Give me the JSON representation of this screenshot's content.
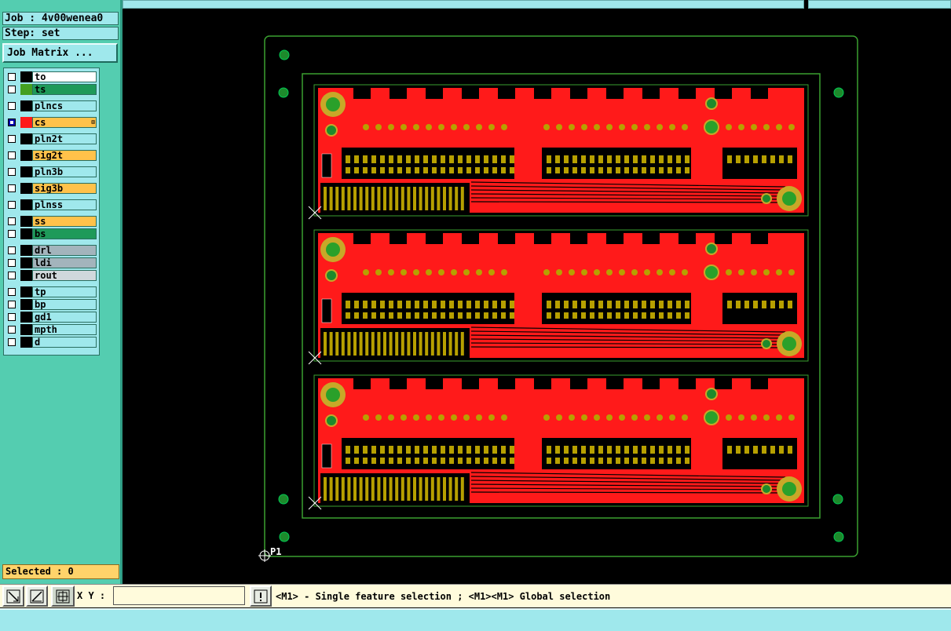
{
  "job": {
    "label": "Job : ",
    "value": "4v00wenea0"
  },
  "step": {
    "label": "Step: ",
    "value": "set"
  },
  "job_matrix_button": "Job Matrix ...",
  "layers": [
    {
      "name": "to",
      "color": "#ffffff",
      "checked": false,
      "swatch": "black"
    },
    {
      "name": "ts",
      "color": "#1e9a5a",
      "checked": false,
      "swatch": "green"
    },
    {
      "name": "plncs",
      "color": "#9fe8ec",
      "checked": false,
      "swatch": "black"
    },
    {
      "name": "cs",
      "color": "#ffc24a",
      "checked": true,
      "swatch": "red",
      "mark": "⊞"
    },
    {
      "name": "pln2t",
      "color": "#9fe8ec",
      "checked": false,
      "swatch": "black"
    },
    {
      "name": "sig2t",
      "color": "#ffc24a",
      "checked": false,
      "swatch": "black"
    },
    {
      "name": "pln3b",
      "color": "#9fe8ec",
      "checked": false,
      "swatch": "black"
    },
    {
      "name": "sig3b",
      "color": "#ffc24a",
      "checked": false,
      "swatch": "black"
    },
    {
      "name": "plnss",
      "color": "#9fe8ec",
      "checked": false,
      "swatch": "black"
    },
    {
      "name": "ss",
      "color": "#ffc24a",
      "checked": false,
      "swatch": "black"
    },
    {
      "name": "bs",
      "color": "#1e9a5a",
      "checked": false,
      "swatch": "black"
    },
    {
      "name": "drl",
      "color": "#a3b4bc",
      "checked": false,
      "swatch": "black"
    },
    {
      "name": "ldi",
      "color": "#a3b4bc",
      "checked": false,
      "swatch": "black"
    },
    {
      "name": "rout",
      "color": "#d0d8dc",
      "checked": false,
      "swatch": "black"
    },
    {
      "name": "tp",
      "color": "#9fe8ec",
      "checked": false,
      "swatch": "black"
    },
    {
      "name": "bp",
      "color": "#9fe8ec",
      "checked": false,
      "swatch": "black"
    },
    {
      "name": "gd1",
      "color": "#9fe8ec",
      "checked": false,
      "swatch": "black"
    },
    {
      "name": "mpth",
      "color": "#9fe8ec",
      "checked": false,
      "swatch": "black"
    },
    {
      "name": "d",
      "color": "#9fe8ec",
      "checked": false,
      "swatch": "black"
    }
  ],
  "selected": {
    "label": "Selected : ",
    "count": "0"
  },
  "xy": {
    "label": "X Y :",
    "value": ""
  },
  "message": "<M1> - Single feature selection ; <M1><M1> Global selection",
  "canvas": {
    "origin_label": "P1",
    "panels": 3,
    "board_color": "#ff1a1a",
    "pad_color": "#b7a000",
    "outline_color": "#3aa030"
  }
}
